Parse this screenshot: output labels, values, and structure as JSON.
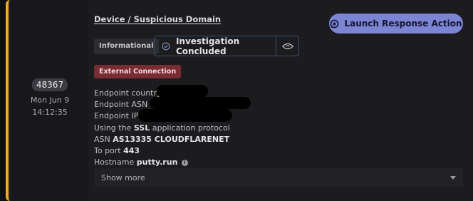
{
  "meta": {
    "incident_id": "48367",
    "date": "Mon Jun 9",
    "time": "14:12:35",
    "accent_color": "#f5a623"
  },
  "header": {
    "title": "Device / Suspicious Domain",
    "launch_button_label": "Launch Response Action",
    "launch_button_icon": "chat-bubble-icon"
  },
  "badges": {
    "severity": "Informational",
    "status": "Investigation Concluded",
    "status_icon": "check-circle-icon",
    "status_action_icon": "eye-icon",
    "tag": "External Connection"
  },
  "details": {
    "endpoint_country_label": "Endpoint country",
    "endpoint_asn_label": "Endpoint ASN",
    "endpoint_ip_label": "Endpoint IP",
    "protocol_prefix": "Using the",
    "protocol_value": "SSL",
    "protocol_suffix": "application protocol",
    "asn_label": "ASN",
    "asn_value": "AS13335 CLOUDFLARENET",
    "port_label": "To port",
    "port_value": "443",
    "hostname_label": "Hostname",
    "hostname_value": "putty.run"
  },
  "show_more": {
    "label": "Show more",
    "icon": "chevron-down-icon"
  }
}
